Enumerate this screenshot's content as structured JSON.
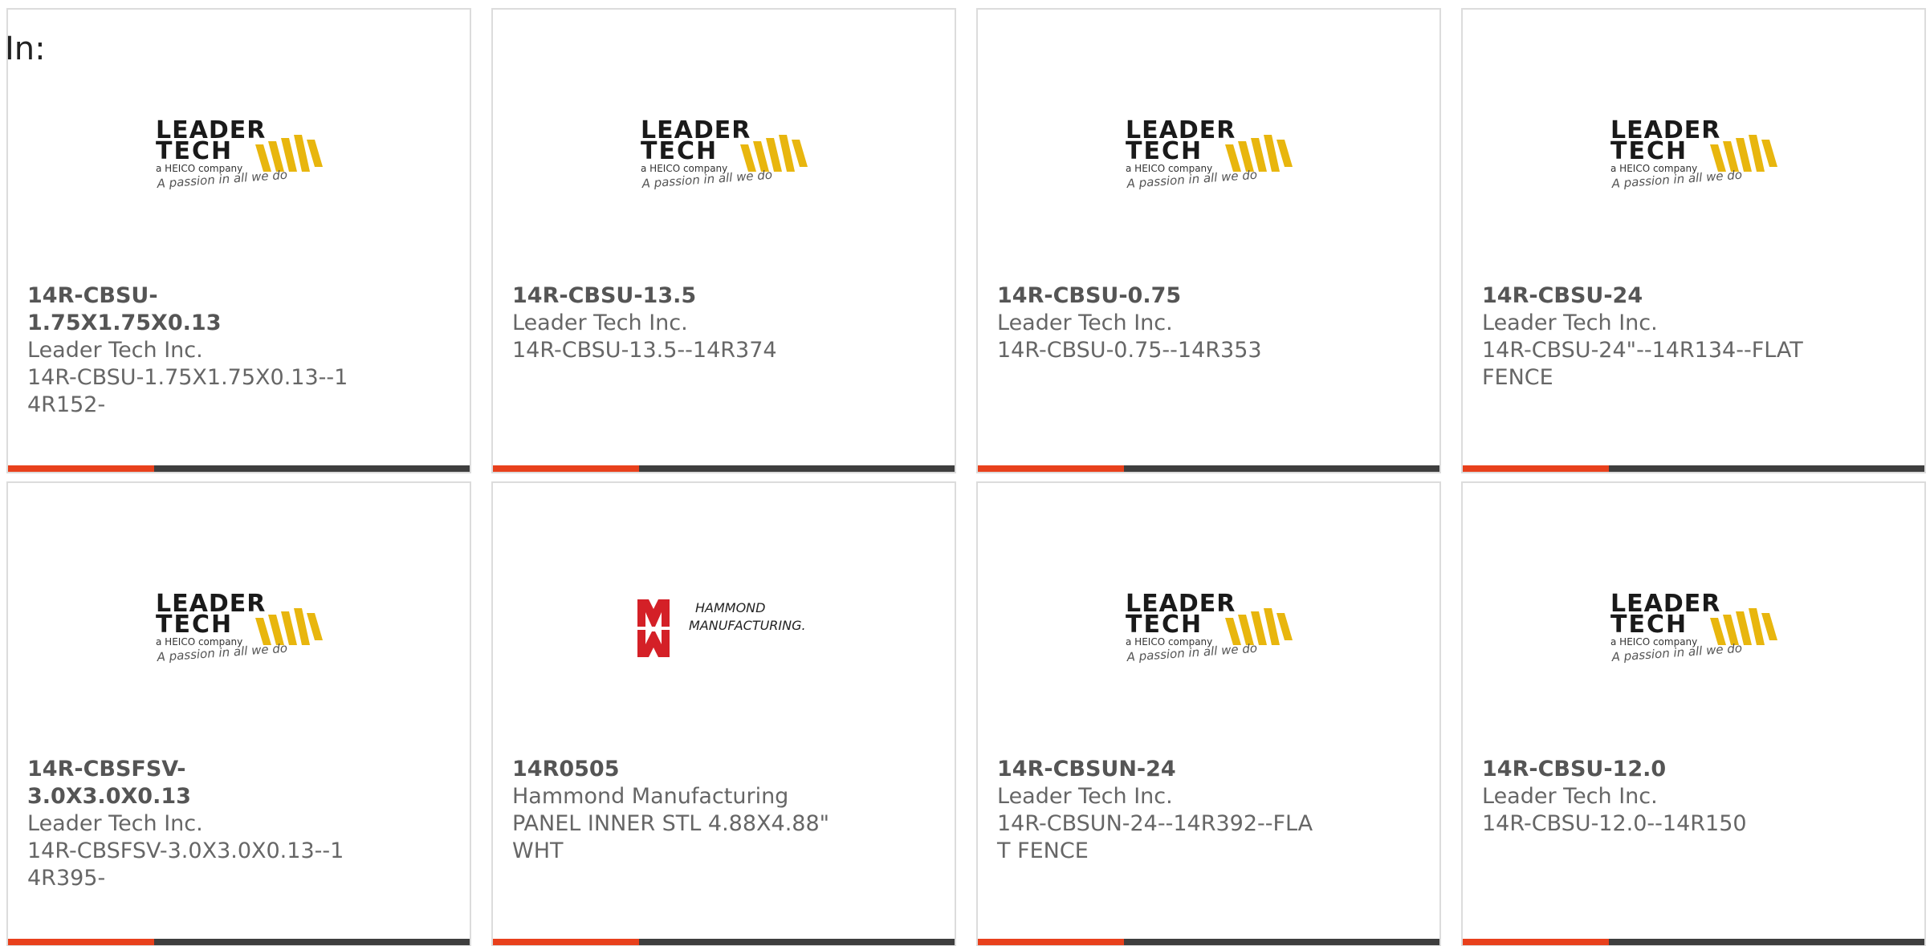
{
  "filter_label": "In:",
  "brands": {
    "leader": {
      "line1": "LEADER",
      "line2": "TECH",
      "sub": "a HEICO company",
      "tagline": "A passion in all we do"
    },
    "hammond": {
      "line1": "HAMMOND",
      "line2": "MANUFACTURING."
    }
  },
  "colors": {
    "accent": "#e8401c",
    "bar_dark": "#3e3e3e",
    "leader_gold": "#e8b60e",
    "hammond_red": "#d42027"
  },
  "products": [
    {
      "part": "14R-CBSU-1.75X1.75X0.13",
      "maker": "Leader Tech Inc.",
      "desc": "14R-CBSU-1.75X1.75X0.13--14R152-",
      "logo": "leader-tech-logo"
    },
    {
      "part": "14R-CBSU-13.5",
      "maker": "Leader Tech Inc.",
      "desc": "14R-CBSU-13.5--14R374",
      "logo": "leader-tech-logo"
    },
    {
      "part": "14R-CBSU-0.75",
      "maker": "Leader Tech Inc.",
      "desc": "14R-CBSU-0.75--14R353",
      "logo": "leader-tech-logo"
    },
    {
      "part": "14R-CBSU-24",
      "maker": "Leader Tech Inc.",
      "desc": "14R-CBSU-24\"--14R134--FLAT FENCE",
      "logo": "leader-tech-logo"
    },
    {
      "part": "14R-CBSFSV-3.0X3.0X0.13",
      "maker": "Leader Tech Inc.",
      "desc": "14R-CBSFSV-3.0X3.0X0.13--14R395-",
      "logo": "leader-tech-logo"
    },
    {
      "part": "14R0505",
      "maker": "Hammond Manufacturing",
      "desc": "PANEL INNER STL 4.88X4.88\" WHT",
      "logo": "hammond-logo"
    },
    {
      "part": "14R-CBSUN-24",
      "maker": "Leader Tech Inc.",
      "desc": "14R-CBSUN-24--14R392--FLAT FENCE",
      "logo": "leader-tech-logo"
    },
    {
      "part": "14R-CBSU-12.0",
      "maker": "Leader Tech Inc.",
      "desc": "14R-CBSU-12.0--14R150",
      "logo": "leader-tech-logo"
    }
  ]
}
